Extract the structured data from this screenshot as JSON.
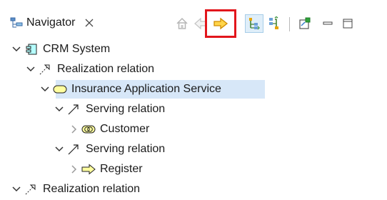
{
  "navigator": {
    "tab_title": "Navigator",
    "tab_icon": "navigator-view-icon",
    "close_icon": "close-icon"
  },
  "toolbar": {
    "buttons": [
      {
        "name": "home-button",
        "icon": "home-icon",
        "state": "disabled"
      },
      {
        "name": "back-button",
        "icon": "back-arrow-icon",
        "state": "disabled"
      },
      {
        "name": "forward-button",
        "icon": "forward-arrow-icon",
        "state": "highlighted",
        "highlight_color": "#e2161c"
      },
      {
        "name": "show-children-toggle",
        "icon": "children-hierarchy-icon",
        "state": "pressed"
      },
      {
        "name": "show-parents-toggle",
        "icon": "parents-hierarchy-icon",
        "state": "normal"
      },
      {
        "name": "pin-button",
        "icon": "pin-view-icon",
        "state": "normal"
      },
      {
        "name": "minimize-button",
        "icon": "minimize-icon",
        "state": "normal"
      },
      {
        "name": "maximize-button",
        "icon": "maximize-icon",
        "state": "normal"
      }
    ]
  },
  "tree": {
    "rows": [
      {
        "label": "CRM System",
        "icon": "application-component-icon",
        "expanded": true,
        "level": 0
      },
      {
        "label": "Realization relation",
        "icon": "realization-relation-icon",
        "expanded": true,
        "level": 1
      },
      {
        "label": "Insurance Application Service",
        "icon": "application-service-icon",
        "expanded": true,
        "level": 2,
        "selected": true
      },
      {
        "label": "Serving relation",
        "icon": "serving-relation-icon",
        "expanded": true,
        "level": 3
      },
      {
        "label": "Customer",
        "icon": "business-service-icon",
        "expanded": false,
        "level": 4
      },
      {
        "label": "Serving relation",
        "icon": "serving-relation-icon",
        "expanded": true,
        "level": 3
      },
      {
        "label": "Register",
        "icon": "process-icon",
        "expanded": false,
        "level": 4
      },
      {
        "label": "Realization relation",
        "icon": "realization-relation-icon",
        "expanded": true,
        "level": 1
      }
    ]
  },
  "colors": {
    "selection": "#d7e7f8",
    "highlight_border": "#e2161c",
    "service_fill": "#ffff9f",
    "arrow_fill": "#ffd54a"
  }
}
